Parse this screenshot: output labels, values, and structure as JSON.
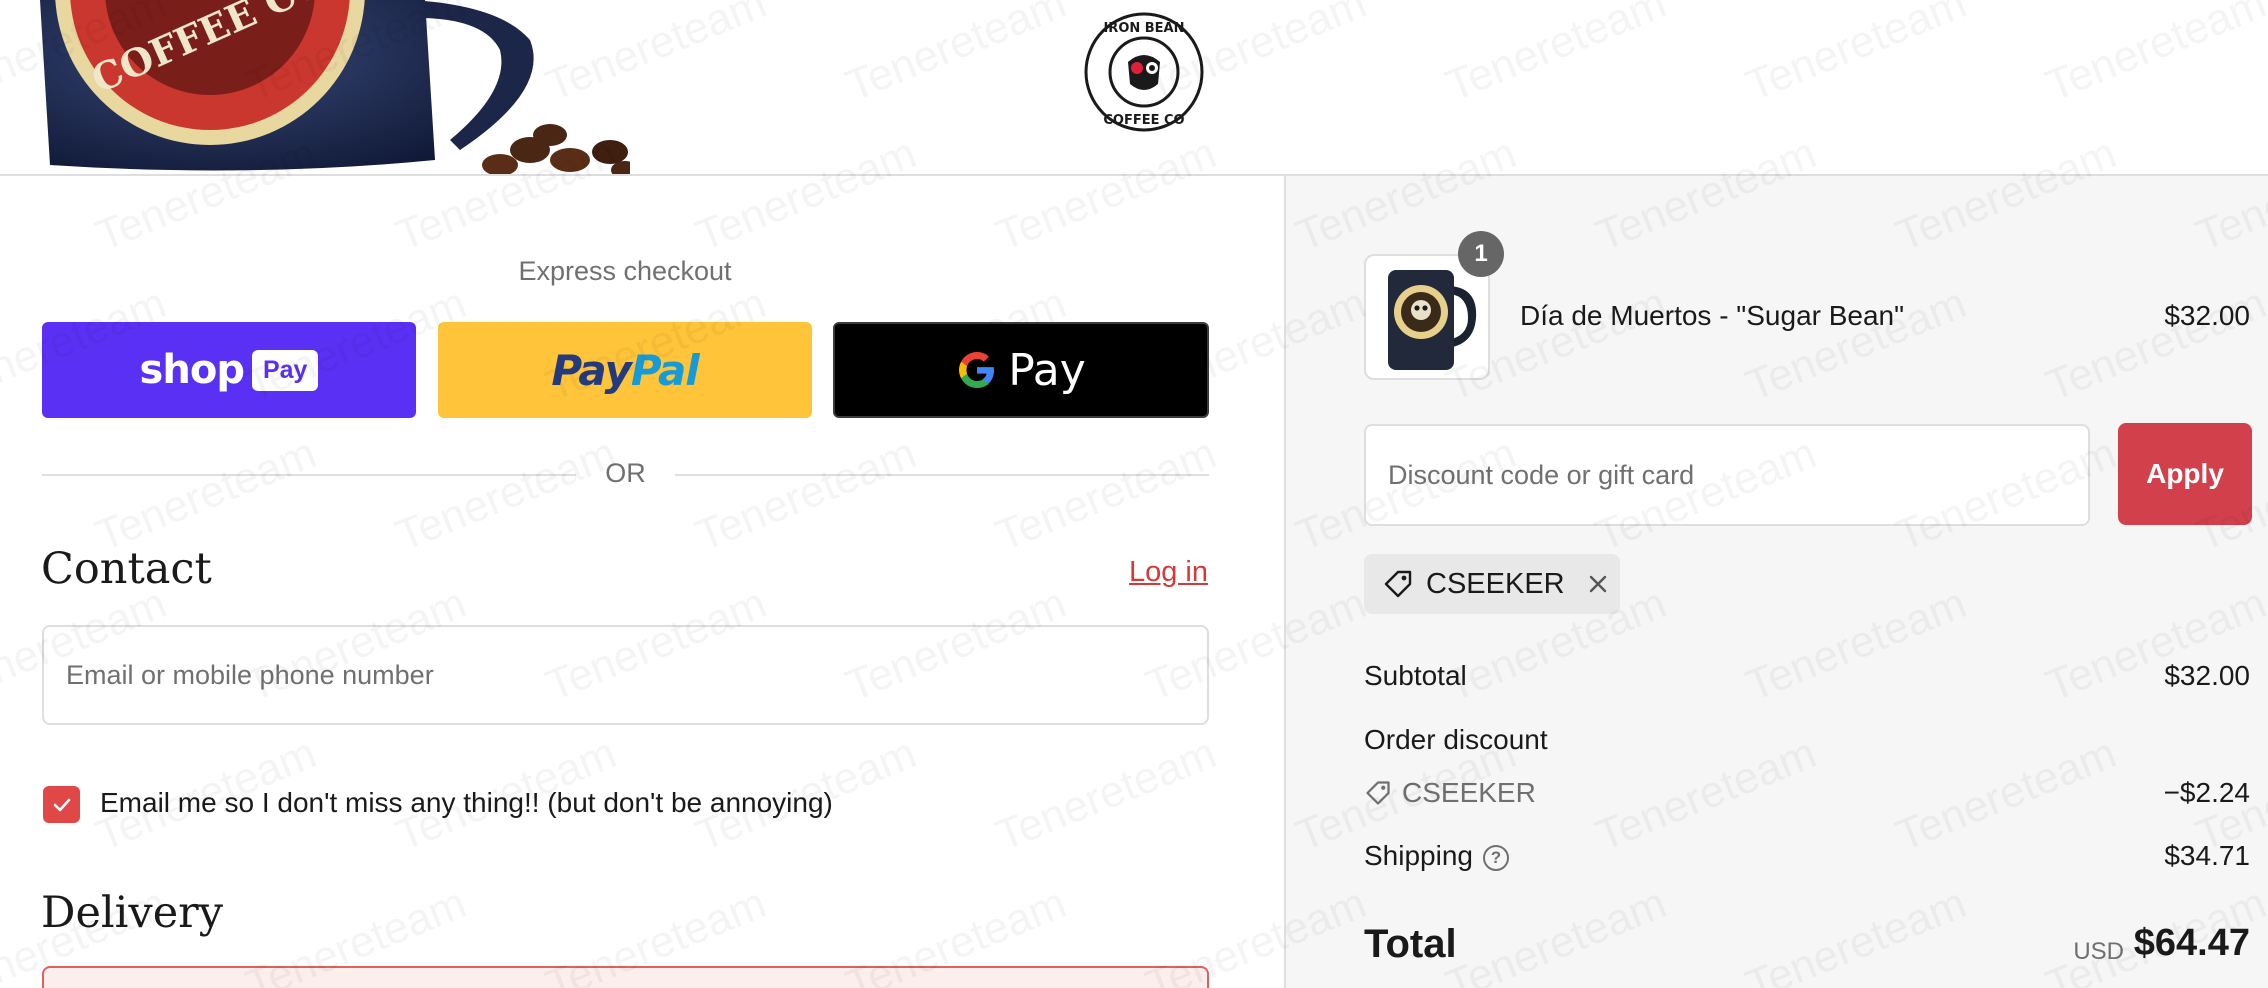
{
  "header": {
    "logo_text": [
      "IRON BEAN",
      "COFFEE CO"
    ],
    "hero_text": "COFFEE CO"
  },
  "express": {
    "title": "Express checkout",
    "shop_pay": {
      "word": "shop",
      "badge": "Pay"
    },
    "paypal": {
      "part1": "Pay",
      "part2": "Pal"
    },
    "gpay": {
      "g": "G",
      "label": "Pay"
    },
    "divider": "OR"
  },
  "contact": {
    "title": "Contact",
    "login": "Log in",
    "email_placeholder": "Email or mobile phone number",
    "email_value": "",
    "newsletter_label": "Email me so I don't miss any thing!! (but don't be annoying)",
    "newsletter_checked": true
  },
  "delivery": {
    "title": "Delivery"
  },
  "summary": {
    "product": {
      "quantity": "1",
      "name": "Día de Muertos - \"Sugar Bean\"",
      "price": "$32.00"
    },
    "discount": {
      "placeholder": "Discount code or gift card",
      "apply": "Apply",
      "applied_code": "CSEEKER"
    },
    "subtotal": {
      "label": "Subtotal",
      "value": "$32.00"
    },
    "order_discount": {
      "label": "Order discount",
      "code": "CSEEKER",
      "value": "−$2.24"
    },
    "shipping": {
      "label": "Shipping",
      "value": "$34.71"
    },
    "total": {
      "label": "Total",
      "currency": "USD",
      "value": "$64.47"
    }
  },
  "watermark": "Tenereteam",
  "colors": {
    "shop_pay": "#5a31f4",
    "paypal": "#ffc439",
    "gpay": "#000000",
    "accent_red": "#d2414b",
    "link_red": "#d43a3a"
  }
}
